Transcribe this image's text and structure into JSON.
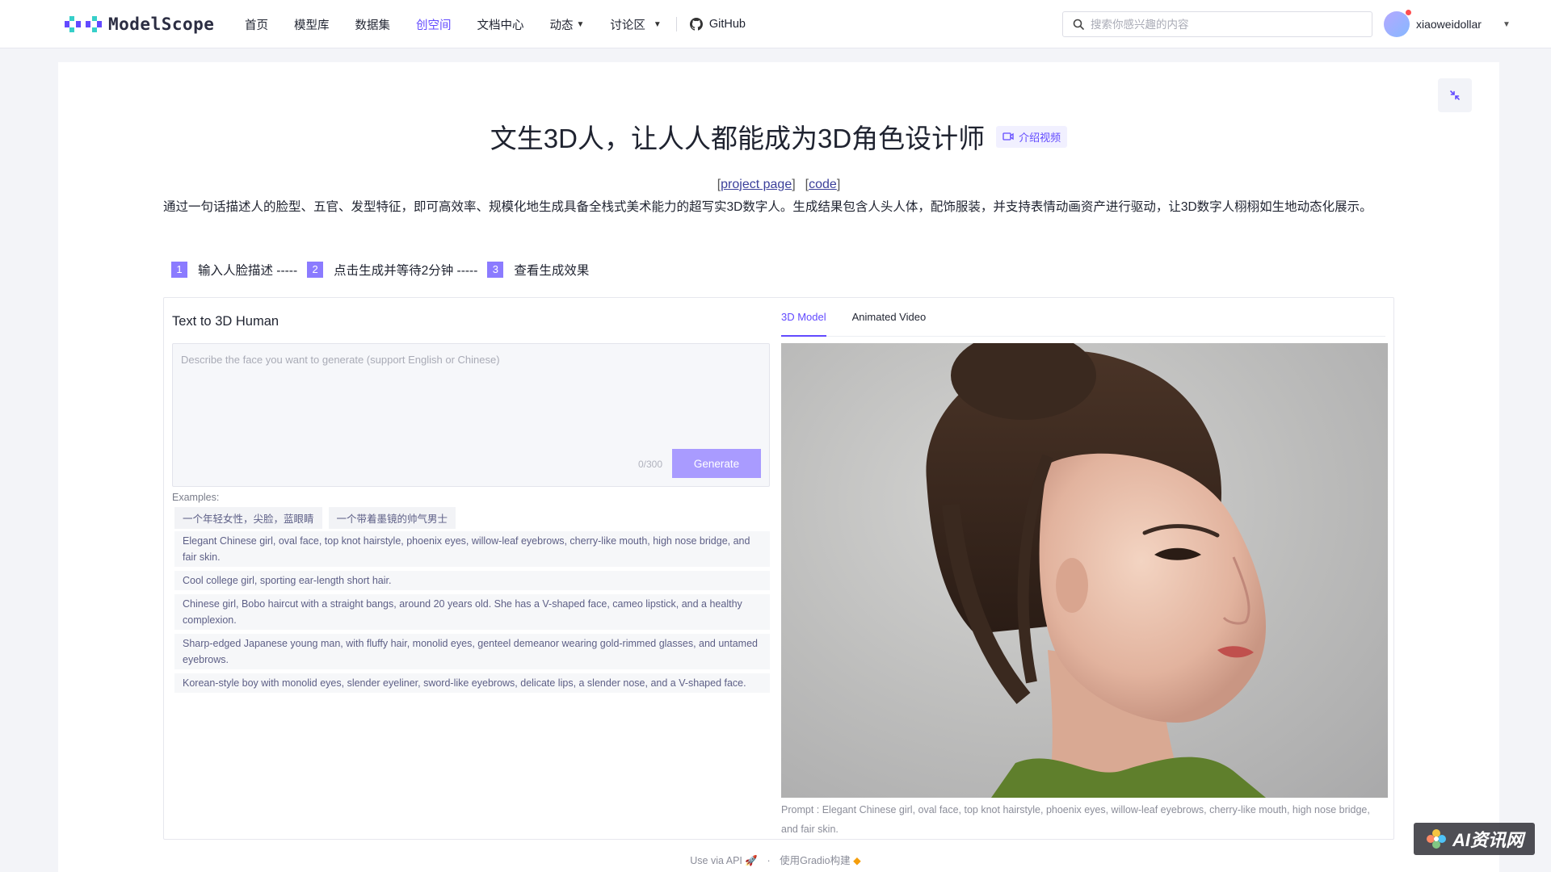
{
  "brand": {
    "name": "ModelScope"
  },
  "nav": {
    "items": [
      {
        "label": "首页",
        "active": false,
        "caret": false
      },
      {
        "label": "模型库",
        "active": false,
        "caret": false
      },
      {
        "label": "数据集",
        "active": false,
        "caret": false
      },
      {
        "label": "创空间",
        "active": true,
        "caret": false
      },
      {
        "label": "文档中心",
        "active": false,
        "caret": false
      },
      {
        "label": "动态",
        "active": false,
        "caret": true
      },
      {
        "label": "讨论区",
        "active": false,
        "caret": true
      }
    ],
    "github_label": "GitHub"
  },
  "search": {
    "placeholder": "搜索你感兴趣的内容"
  },
  "user": {
    "name": "xiaoweidollar"
  },
  "page": {
    "title": "文生3D人，让人人都能成为3D角色设计师",
    "intro_video_label": "介绍视频",
    "project_link": "project page",
    "code_link": "code",
    "description": "通过一句话描述人的脸型、五官、发型特征，即可高效率、规模化地生成具备全栈式美术能力的超写实3D数字人。生成结果包含人头人体，配饰服装，并支持表情动画资产进行驱动，让3D数字人栩栩如生地动态化展示。",
    "steps": [
      {
        "num": "1",
        "text": "输入人脸描述 -----"
      },
      {
        "num": "2",
        "text": "点击生成并等待2分钟 -----"
      },
      {
        "num": "3",
        "text": "查看生成效果"
      }
    ]
  },
  "app": {
    "block_label": "Text to 3D Human",
    "prompt_placeholder": "Describe the face you want to generate (support English or Chinese)",
    "prompt_value": "",
    "char_count": "0/300",
    "generate_label": "Generate",
    "examples_label": "Examples:",
    "example_chips": [
      "一个年轻女性，尖脸，蓝眼睛",
      "一个带着墨镜的帅气男士"
    ],
    "examples": [
      "Elegant Chinese girl, oval face, top knot hairstyle, phoenix eyes, willow-leaf eyebrows, cherry-like mouth, high nose bridge, and fair skin.",
      "Cool college girl, sporting ear-length short hair.",
      "Chinese girl, Bobo haircut with a straight bangs, around 20 years old. She has a V-shaped face, cameo lipstick, and a healthy complexion.",
      "Sharp-edged Japanese young man, with fluffy hair, monolid eyes, genteel demeanor wearing gold-rimmed glasses, and untamed eyebrows.",
      "Korean-style boy with monolid eyes, slender eyeliner, sword-like eyebrows, delicate lips, a slender nose, and a V-shaped face."
    ],
    "tabs": [
      {
        "label": "3D Model",
        "active": true
      },
      {
        "label": "Animated Video",
        "active": false
      }
    ],
    "caption": "Prompt : Elegant Chinese girl, oval face, top knot hairstyle, phoenix eyes, willow-leaf eyebrows, cherry-like mouth, high nose bridge, and fair skin."
  },
  "footer": {
    "api_label": "Use via API",
    "dot": "·",
    "gradio_label": "使用Gradio构建"
  },
  "watermark": {
    "text": "AI资讯网"
  },
  "colors": {
    "accent": "#624aff",
    "accent_light": "#a99bff",
    "step_badge": "#8b7bff"
  },
  "icons": [
    "modelscope-logo-icon",
    "github-icon",
    "search-icon",
    "video-icon",
    "collapse-icon",
    "rocket-icon",
    "gradio-icon",
    "chevron-down-icon"
  ]
}
